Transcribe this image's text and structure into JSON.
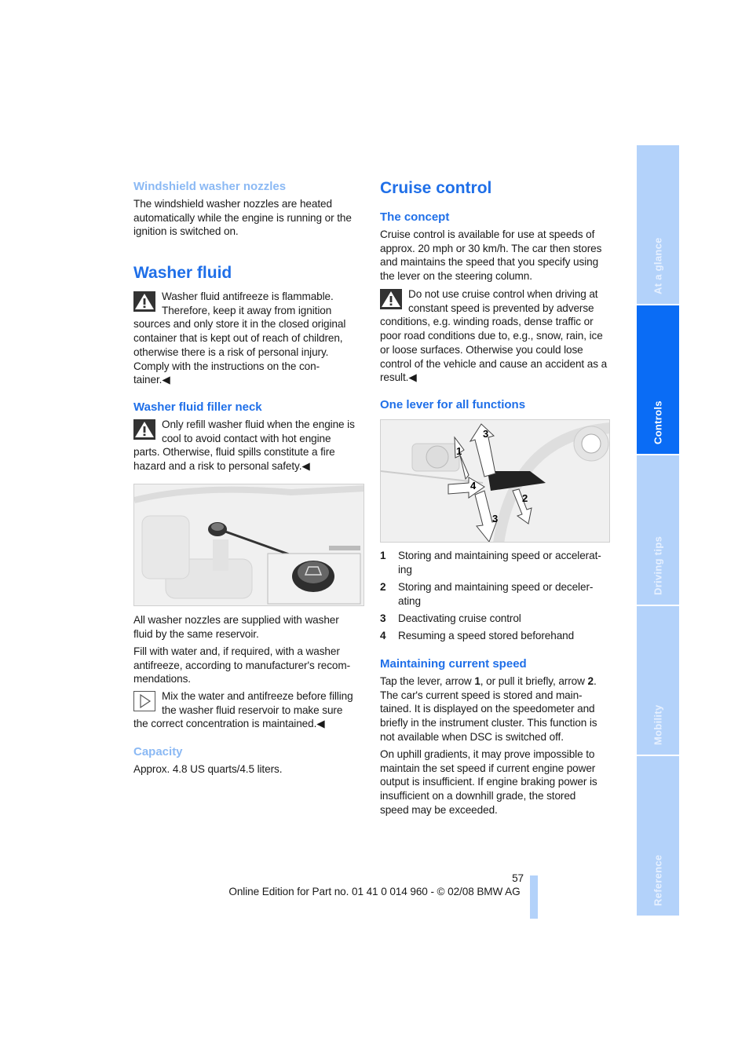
{
  "left": {
    "nozzles": {
      "heading": "Windshield washer nozzles",
      "lines": [
        "The windshield washer nozzles are heated",
        "automatically while the engine is running or the",
        "ignition is switched on."
      ]
    },
    "washer_fluid": {
      "heading": "Washer fluid",
      "warning_lines": [
        "Washer fluid antifreeze is flammable.",
        "Therefore, keep it away from ignition",
        "sources and only store it in the closed original",
        "container that is kept out of reach of children,",
        "otherwise there is a risk of personal injury.",
        "Comply with the instructions on the con-",
        "tainer.◀"
      ]
    },
    "filler_neck": {
      "heading": "Washer fluid filler neck",
      "warning_lines": [
        "Only refill washer fluid when the engine is",
        "cool to avoid contact with hot engine",
        "parts. Otherwise, fluid spills constitute a fire",
        "hazard and a risk to personal safety.◀"
      ]
    },
    "para1": [
      "All washer nozzles are supplied with washer",
      "fluid by the same reservoir."
    ],
    "para2": [
      "Fill with water and, if required, with a washer",
      "antifreeze, according to manufacturer's recom-",
      "mendations."
    ],
    "note_lines": [
      "Mix the water and antifreeze before filling",
      "the washer fluid reservoir to make sure",
      "the correct concentration is maintained.◀"
    ],
    "capacity": {
      "heading": "Capacity",
      "lines": [
        "Approx. 4.8 US quarts/4.5 liters."
      ]
    }
  },
  "right": {
    "title": "Cruise control",
    "concept": {
      "heading": "The concept",
      "lines": [
        "Cruise control is available for use at speeds of",
        "approx. 20 mph or 30 km/h. The car then stores",
        "and maintains the speed that you specify using",
        "the lever on the steering column."
      ],
      "warning_lines": [
        "Do not use cruise control when driving at",
        "constant speed is prevented by adverse",
        "conditions, e.g. winding roads, dense traffic or",
        "poor road conditions due to, e.g., snow, rain, ice",
        "or loose surfaces. Otherwise you could lose",
        "control of the vehicle and cause an accident as a",
        "result.◀"
      ]
    },
    "one_lever": {
      "heading": "One lever for all functions",
      "arrow_labels": [
        "1",
        "2",
        "3",
        "4"
      ],
      "items": [
        {
          "num": "1",
          "lines": [
            "Storing and maintaining speed or accelerat-",
            "ing"
          ]
        },
        {
          "num": "2",
          "lines": [
            "Storing and maintaining speed or deceler-",
            "ating"
          ]
        },
        {
          "num": "3",
          "lines": [
            "Deactivating cruise control"
          ]
        },
        {
          "num": "4",
          "lines": [
            "Resuming a speed stored beforehand"
          ]
        }
      ]
    },
    "maintaining": {
      "heading": "Maintaining current speed",
      "first_line": [
        {
          "t": "Tap the lever, arrow "
        },
        {
          "b": "1"
        },
        {
          "t": ", or pull it briefly, arrow "
        },
        {
          "b": "2"
        },
        {
          "t": "."
        }
      ],
      "lines": [
        "The car's current speed is stored and main-",
        "tained. It is displayed on the speedometer and",
        "briefly in the instrument cluster. This function is",
        "not available when DSC is switched off."
      ],
      "para2": [
        "On uphill gradients, it may prove impossible to",
        "maintain the set speed if current engine power",
        "output is insufficient. If engine braking power is",
        "insufficient on a downhill grade, the stored",
        "speed may be exceeded."
      ]
    }
  },
  "sidebar": {
    "tabs": [
      {
        "label": "At a glance",
        "active": false
      },
      {
        "label": "Controls",
        "active": true
      },
      {
        "label": "Driving tips",
        "active": false
      },
      {
        "label": "Mobility",
        "active": false
      },
      {
        "label": "Reference",
        "active": false
      }
    ]
  },
  "footer": {
    "page_number": "57",
    "edition": "Online Edition for Part no. 01 41 0 014 960 - © 02/08 BMW AG"
  },
  "colors": {
    "heading": "#1f6fe8",
    "subheading_light": "#8bb9f4",
    "tab_inactive": "#b3d2fa",
    "tab_active": "#0a6cf5"
  }
}
